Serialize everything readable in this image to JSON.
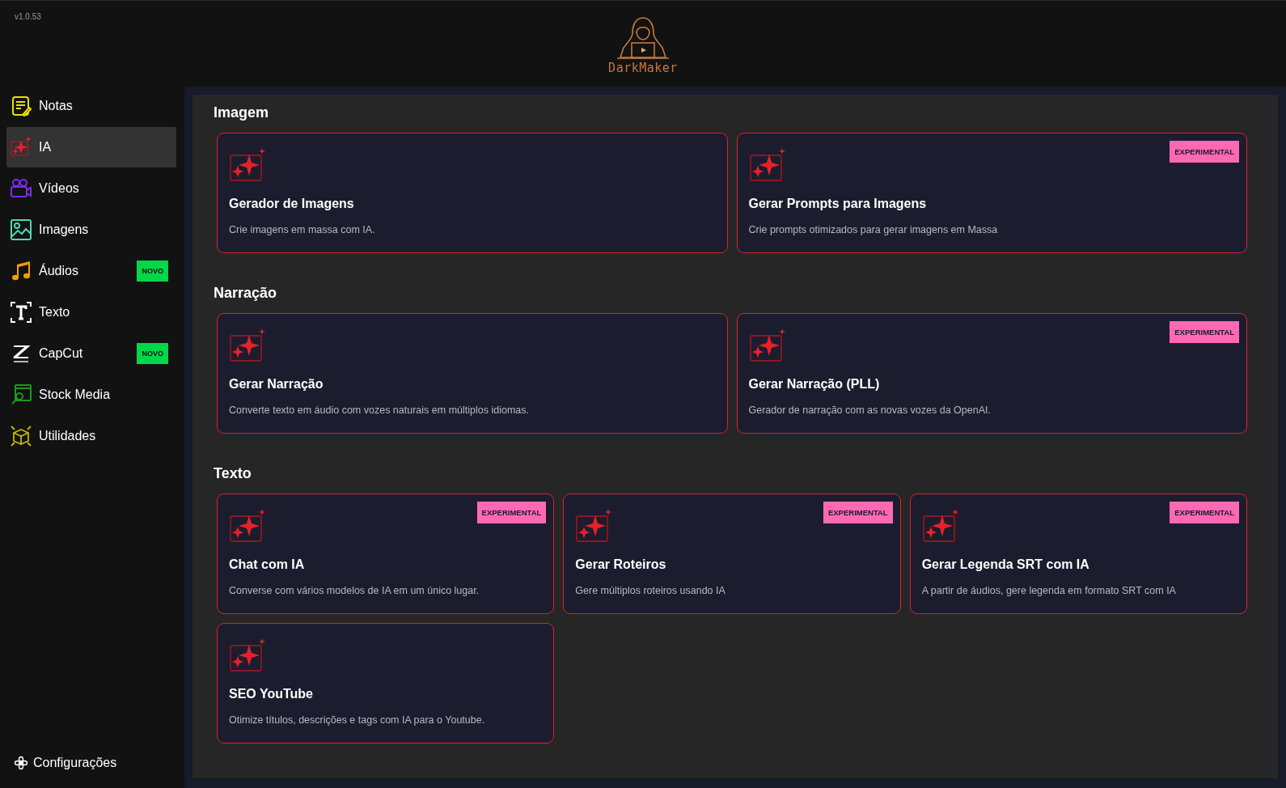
{
  "version": "v1.0.53",
  "logo": {
    "text": "DarkMaker"
  },
  "sidebar": {
    "items": [
      {
        "label": "Notas",
        "selected": false
      },
      {
        "label": "IA",
        "selected": true
      },
      {
        "label": "Vídeos",
        "selected": false
      },
      {
        "label": "Imagens",
        "selected": false
      },
      {
        "label": "Áudios",
        "selected": false,
        "badge": "NOVO"
      },
      {
        "label": "Texto",
        "selected": false
      },
      {
        "label": "CapCut",
        "selected": false,
        "badge": "NOVO"
      },
      {
        "label": "Stock Media",
        "selected": false
      },
      {
        "label": "Utilidades",
        "selected": false
      }
    ],
    "footer": {
      "label": "Configurações"
    }
  },
  "sections": [
    {
      "title": "Imagem",
      "cards": [
        {
          "title": "Gerador de Imagens",
          "description": "Crie imagens em massa com IA."
        },
        {
          "title": "Gerar Prompts para Imagens",
          "description": "Crie prompts otimizados para gerar imagens em Massa",
          "badge": "EXPERIMENTAL"
        }
      ]
    },
    {
      "title": "Narração",
      "cards": [
        {
          "title": "Gerar Narração",
          "description": "Converte texto em áudio com vozes naturais em múltiplos idiomas."
        },
        {
          "title": "Gerar Narração (PLL)",
          "description": "Gerador de narração com as novas vozes da OpenAI.",
          "badge": "EXPERIMENTAL"
        }
      ]
    },
    {
      "title": "Texto",
      "cards": [
        {
          "title": "Chat com IA",
          "description": "Converse com vários modelos de IA em um único lugar.",
          "badge": "EXPERIMENTAL"
        },
        {
          "title": "Gerar Roteiros",
          "description": "Gere múltiplos roteiros usando IA",
          "badge": "EXPERIMENTAL"
        },
        {
          "title": "Gerar Legenda SRT com IA",
          "description": "A partir de áudios, gere legenda em formato SRT com IA",
          "badge": "EXPERIMENTAL"
        },
        {
          "title": "SEO YouTube",
          "description": "Otimize títulos, descrições e tags com IA para o Youtube."
        }
      ]
    }
  ]
}
